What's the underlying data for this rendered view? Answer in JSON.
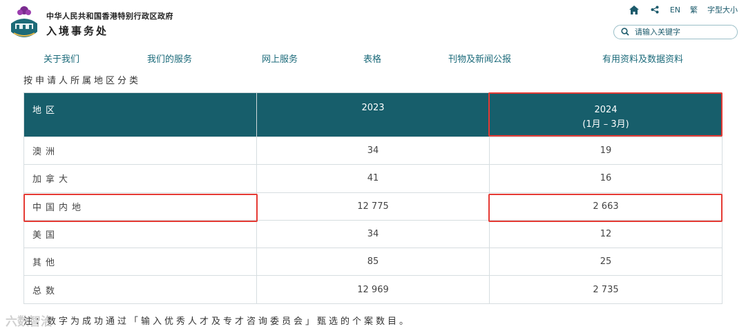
{
  "header": {
    "gov_title": "中华人民共和国香港特别行政区政府",
    "dept_title": "入境事务处",
    "utilities": {
      "home_icon": "home-icon",
      "share_icon": "share-icon",
      "lang_en": "EN",
      "lang_trad": "繁",
      "font_size": "字型大小"
    },
    "search": {
      "placeholder": "请输入关键字",
      "icon": "search-icon"
    }
  },
  "nav": [
    "关于我们",
    "我们的服务",
    "网上服务",
    "表格",
    "刊物及新闻公报",
    "有用资料及数据资料"
  ],
  "section_title": "按申请人所属地区分类",
  "table": {
    "headers": {
      "region": "地区",
      "y2023": "2023",
      "y2024": "2024",
      "y2024_sub": "(1月  – 3月)"
    },
    "rows": [
      {
        "region": "澳洲",
        "v2023": "34",
        "v2024": "19"
      },
      {
        "region": "加拿大",
        "v2023": "41",
        "v2024": "16"
      },
      {
        "region": "中国内地",
        "v2023": "12 775",
        "v2024": "2 663"
      },
      {
        "region": "美国",
        "v2023": "34",
        "v2024": "12"
      },
      {
        "region": "其他",
        "v2023": "85",
        "v2024": "25"
      },
      {
        "region": "总数",
        "v2023": "12 969",
        "v2024": "2 735"
      }
    ]
  },
  "note": "注：数字为成功通过「输入优秀人才及专才咨询委员会」甄选的个案数目。",
  "watermark": "六数智治",
  "colors": {
    "header_bg": "#175e6b",
    "highlight": "#e53a34",
    "link": "#1b6a7a"
  }
}
